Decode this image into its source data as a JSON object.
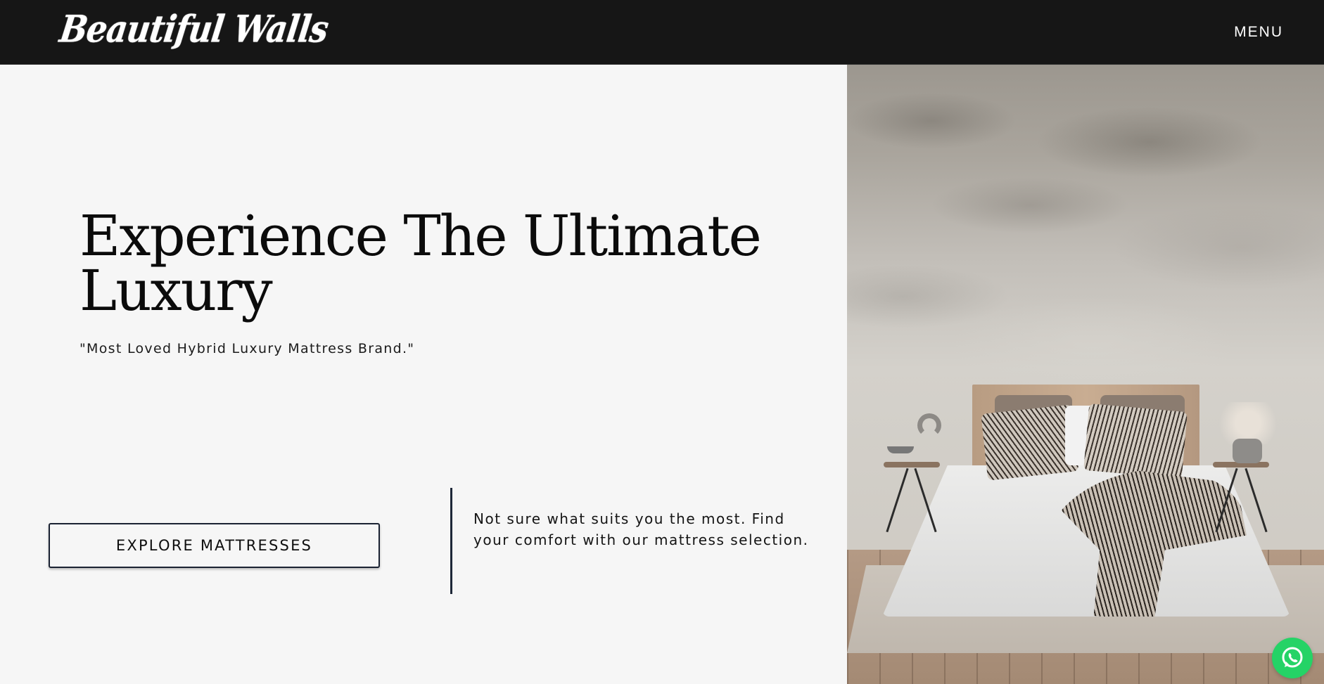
{
  "header": {
    "logo_text": "Beautiful Walls",
    "menu_label": "MENU"
  },
  "hero": {
    "headline": "Experience The Ultimate Luxury",
    "tagline": "\"Most Loved Hybrid Luxury Mattress Brand.\"",
    "cta_label": "EXPLORE MATTRESSES",
    "helper_text": "Not sure what suits you the most. Find your comfort with our mattress selection."
  },
  "colors": {
    "header_bg": "#161616",
    "page_bg": "#f6f6f6",
    "cta_border": "#1a2232",
    "whatsapp": "#25d366"
  },
  "icons": {
    "chat": "whatsapp-icon"
  }
}
